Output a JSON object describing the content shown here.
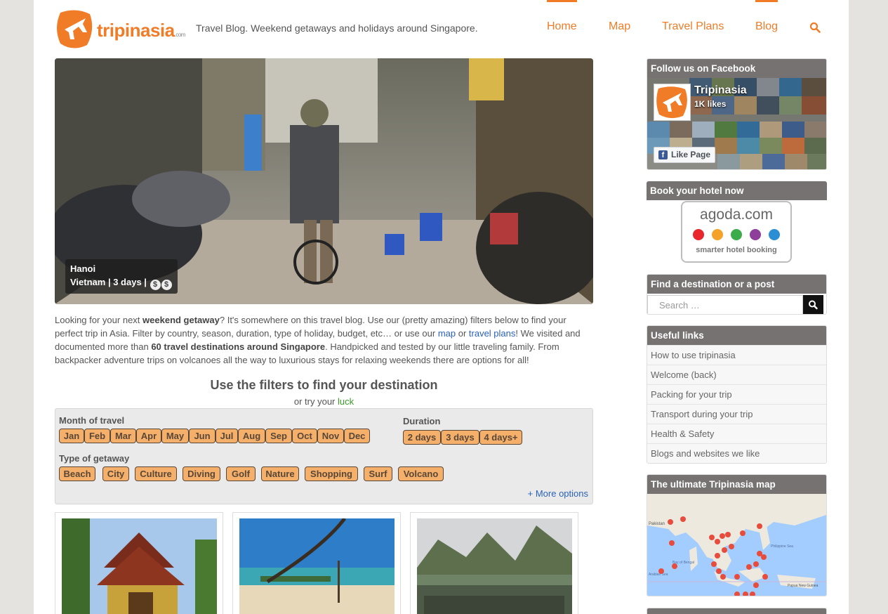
{
  "header": {
    "logo_text": "tripinasia",
    "logo_suffix": ".com",
    "tagline": "Travel Blog. Weekend getaways and holidays around Singapore.",
    "nav": [
      {
        "label": "Home",
        "active": true
      },
      {
        "label": "Map",
        "active": false
      },
      {
        "label": "Travel Plans",
        "active": false
      },
      {
        "label": "Blog",
        "active": true
      }
    ],
    "search_icon": "search-icon"
  },
  "hero": {
    "city": "Hanoi",
    "details": "Vietnam | 3 days |",
    "budget_icons": [
      "$",
      "$"
    ]
  },
  "intro": {
    "p1": "Looking for your next ",
    "b1": "weekend getaway",
    "p2": "? It's somewhere on this travel blog. Use our (pretty amazing) filters below to find your perfect trip in Asia. Filter by country, season, duration, type of holiday, budget, etc… or use our ",
    "link_map": "map",
    "p3": " or ",
    "link_plans": "travel plans",
    "p4": "! We visited and documented more than ",
    "b2": "60 travel destinations around Singapore",
    "p5": ". Handpicked and tested by our little traveling family. From backpacker adventure trips on volcanoes all the way to luxurious stays for relaxing weekends there are options for all!"
  },
  "filters": {
    "title": "Use the filters to find your destination",
    "subtitle_prefix": "or try your ",
    "subtitle_link": "luck",
    "month_label": "Month of travel",
    "months": [
      "Jan",
      "Feb",
      "Mar",
      "Apr",
      "May",
      "Jun",
      "Jul",
      "Aug",
      "Sep",
      "Oct",
      "Nov",
      "Dec"
    ],
    "duration_label": "Duration",
    "durations": [
      "2 days",
      "3 days",
      "4 days+"
    ],
    "type_label": "Type of getaway",
    "types": [
      "Beach",
      "City",
      "Culture",
      "Diving",
      "Golf",
      "Nature",
      "Shopping",
      "Surf",
      "Volcano"
    ],
    "more_options": "+ More options"
  },
  "sidebar": {
    "facebook": {
      "title": "Follow us on Facebook",
      "page_name": "Tripinasia",
      "likes": "1K likes",
      "like_button": "Like Page"
    },
    "hotel": {
      "title": "Book your hotel now",
      "brand": "agoda.com",
      "slogan": "smarter hotel booking",
      "dot_colors": [
        "#e8262c",
        "#f5a22a",
        "#3cab4a",
        "#8d3f9a",
        "#2c8fd6"
      ]
    },
    "search": {
      "title": "Find a destination or a post",
      "placeholder": "Search …"
    },
    "links": {
      "title": "Useful links",
      "items": [
        "How to use tripinasia",
        "Welcome (back)",
        "Packing for your trip",
        "Transport during your trip",
        "Health & Safety",
        "Blogs and websites we like"
      ]
    },
    "map": {
      "title": "The ultimate Tripinasia map",
      "labels": [
        "Pakistan",
        "Bay of Bengal",
        "Philippine Sea",
        "Arabian Sea",
        "Papua New Guinea"
      ]
    }
  },
  "colors": {
    "accent": "#f07c28",
    "widget_header": "#767272",
    "link": "#2a62b8",
    "pill": "#f4b06a"
  }
}
